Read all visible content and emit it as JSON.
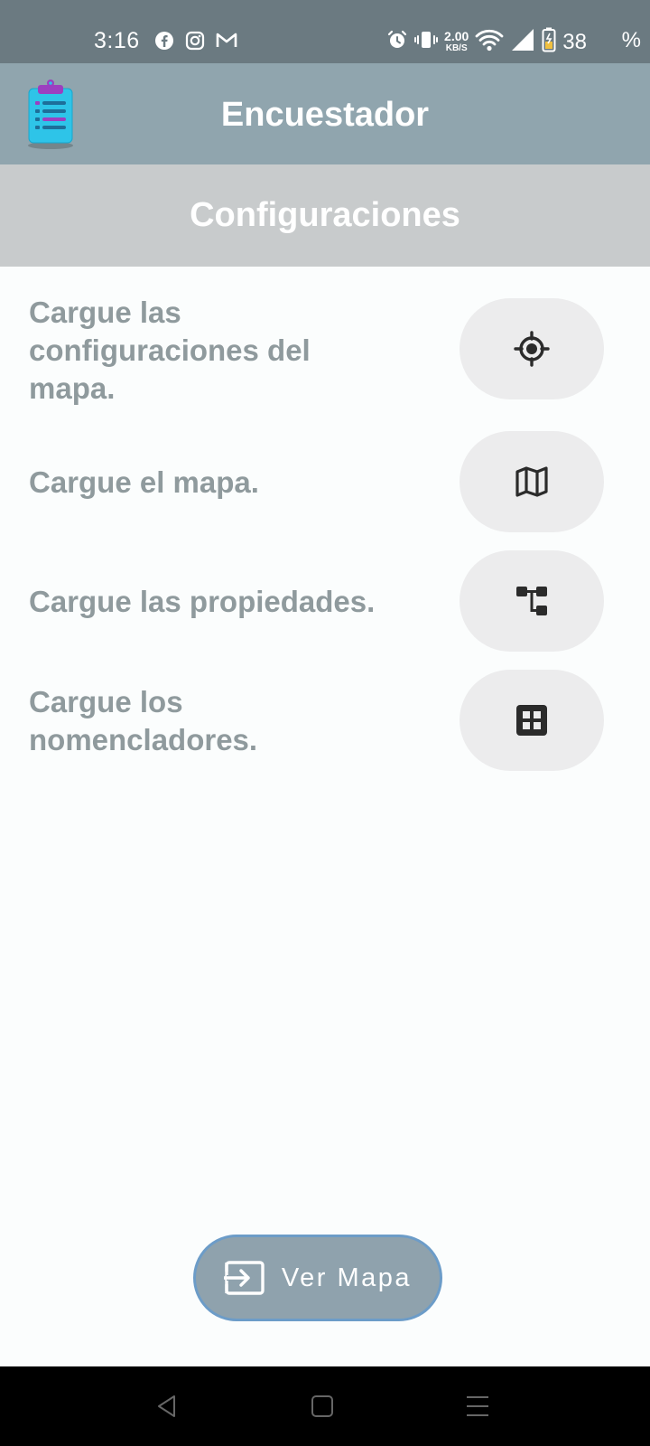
{
  "status_bar": {
    "time": "3:16",
    "left_icons": [
      "facebook-icon",
      "instagram-icon",
      "gmail-icon"
    ],
    "speed_value": "2.00",
    "speed_unit": "KB/S",
    "battery_percent": "38",
    "battery_unit": "%"
  },
  "app_bar": {
    "title": "Encuestador",
    "logo": "clipboard-icon"
  },
  "section": {
    "title": "Configuraciones"
  },
  "config_items": [
    {
      "label": "Cargue las configuraciones del mapa.",
      "icon": "gps-target-icon"
    },
    {
      "label": "Cargue el mapa.",
      "icon": "map-icon"
    },
    {
      "label": "Cargue las propiedades.",
      "icon": "tree-structure-icon"
    },
    {
      "label": "Cargue los nomencladores.",
      "icon": "grid-icon"
    }
  ],
  "footer": {
    "ver_mapa_label": "Ver Mapa",
    "ver_mapa_icon": "enter-arrow-icon"
  },
  "colors": {
    "status_bar": "#6b7a81",
    "app_bar": "#90a5ae",
    "section_header": "#c8cbcc",
    "label_text": "#8f9a9d",
    "config_button": "#ececed",
    "ver_mapa_button": "#8fa2ad",
    "ver_mapa_border": "#6c9cc8"
  }
}
